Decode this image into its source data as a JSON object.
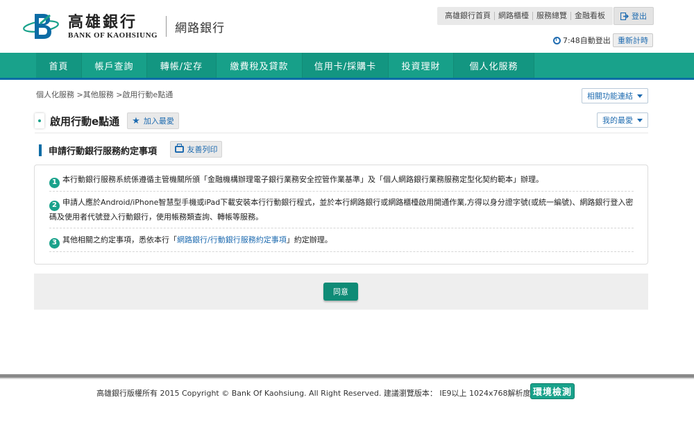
{
  "header": {
    "logo_zh": "高雄銀行",
    "logo_en": "BANK OF KAOHSIUNG",
    "subtitle": "網路銀行",
    "top_links": [
      "高雄銀行首頁",
      "網路櫃檯",
      "服務總覽",
      "金融看板"
    ],
    "logout_label": "登出",
    "session_text": "7:48自動登出",
    "renew_label": "重新計時"
  },
  "nav": {
    "items": [
      "首頁",
      "帳戶查詢",
      "轉帳/定存",
      "繳費稅及貸款",
      "信用卡/採購卡",
      "投資理財",
      "個人化服務"
    ]
  },
  "breadcrumb": "個人化服務 >其他服務 >啟用行動e點通",
  "related_label": "相關功能連結",
  "page_title": "啟用行動e點通",
  "fav_label": "加入最愛",
  "myfav_label": "我的最愛",
  "section": {
    "title": "申請行動銀行服務約定事項",
    "print_label": "友善列印"
  },
  "items": [
    {
      "num": "1",
      "text": "本行動銀行服務系統係遵循主管機關所頒「金融機構辦理電子銀行業務安全控管作業基準」及「個人網路銀行業務服務定型化契約範本」辦理。"
    },
    {
      "num": "2",
      "text": "申請人應於Android/iPhone智慧型手機或iPad下載安裝本行行動銀行程式，並於本行網路銀行或網路櫃檯啟用開通作業,方得以身分證字號(或統一編號)、網路銀行登入密碼及使用者代號登入行動銀行，使用帳務類查詢、轉帳等服務。"
    },
    {
      "num": "3",
      "text_before": "其他相關之約定事項，悉依本行「",
      "link": "網路銀行/行動銀行服務約定事項",
      "text_after": "」約定辦理。"
    }
  ],
  "agree_label": "同意",
  "footer": {
    "copyright": "高雄銀行版權所有 2015 Copyright © Bank Of Kaohsiung. All Right Reserved. 建議瀏覽版本： IE9以上 1024x768解析度為佳",
    "env_label": "環境檢測"
  },
  "colors": {
    "brand_green": "#19a28b",
    "brand_blue": "#0c6ca5",
    "link_blue": "#1e6bb0"
  }
}
